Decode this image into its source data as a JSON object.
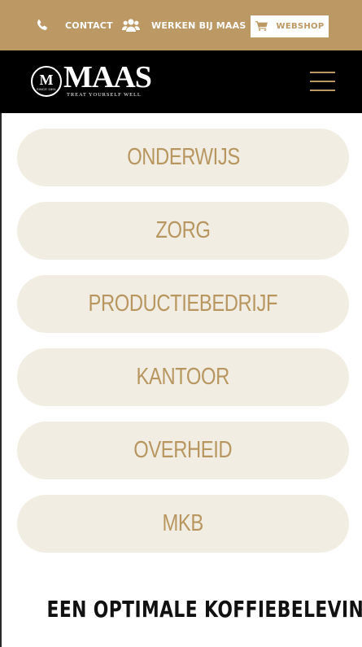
{
  "topbar": {
    "contact_label": "CONTACT",
    "contact_icon": "phone-icon",
    "werken_label": "WERKEN BIJ MAAS",
    "werken_icon": "users-icon",
    "webshop_label": "WEBSHOP",
    "webshop_icon": "cart-icon"
  },
  "navbar": {
    "logo_letter": "M",
    "logo_since": "SINCE 1891",
    "logo_word": "MAAS",
    "logo_tagline": "TREAT YOURSELF WELL",
    "menu_icon": "hamburger-menu-icon"
  },
  "sectors": [
    {
      "label": "ONDERWIJS"
    },
    {
      "label": "ZORG"
    },
    {
      "label": "PRODUCTIEBEDRIJF"
    },
    {
      "label": "KANTOOR"
    },
    {
      "label": "OVERHEID"
    },
    {
      "label": "MKB"
    }
  ],
  "tagline": "EEN OPTIMALE KOFFIEBELEVING",
  "colors": {
    "brand_gold": "#bb9864",
    "pill_bg": "#f1ede2",
    "navbar_bg": "#000000",
    "text_dark": "#111111"
  }
}
